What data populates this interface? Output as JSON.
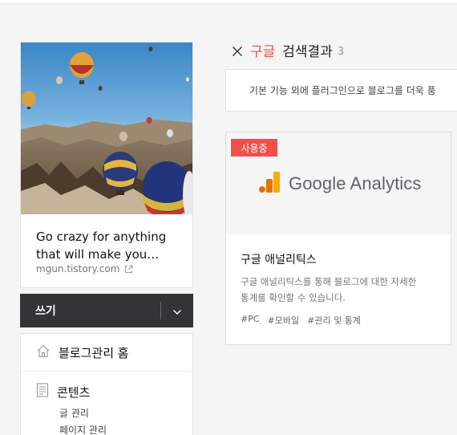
{
  "blog": {
    "title_line1": "Go crazy for anything",
    "title_line2": "that will make you…",
    "url": "mgun.tistory.com"
  },
  "write": {
    "label": "쓰기"
  },
  "menu": {
    "home_label": "블로그관리 홈",
    "content_label": "콘텐츠",
    "sub_items": [
      "글 관리",
      "페이지 관리"
    ]
  },
  "search": {
    "query": "구글",
    "suffix": "검색결과",
    "count": "3"
  },
  "description": "기본 기능 외에 플러그인으로 블로그를 더욱 풍",
  "plugin": {
    "badge": "사용중",
    "logo_text": "Google Analytics",
    "name": "구글 애널리틱스",
    "desc_line1": "구글 애널리틱스를 통해 블로그에 대한 자세한",
    "desc_line2": "통계를 확인할 수 있습니다.",
    "tags": [
      "#PC",
      "#모바일",
      "#관리 및 통계"
    ]
  },
  "colors": {
    "accent": "#f1504a",
    "write_bar": "#333436",
    "ga_orange": "#f9ab00",
    "ga_dark_orange": "#e37400"
  },
  "icons": {
    "close": "close-icon",
    "home": "home-icon",
    "content": "document-icon",
    "external": "external-link-icon",
    "dropdown": "chevron-down-icon"
  }
}
